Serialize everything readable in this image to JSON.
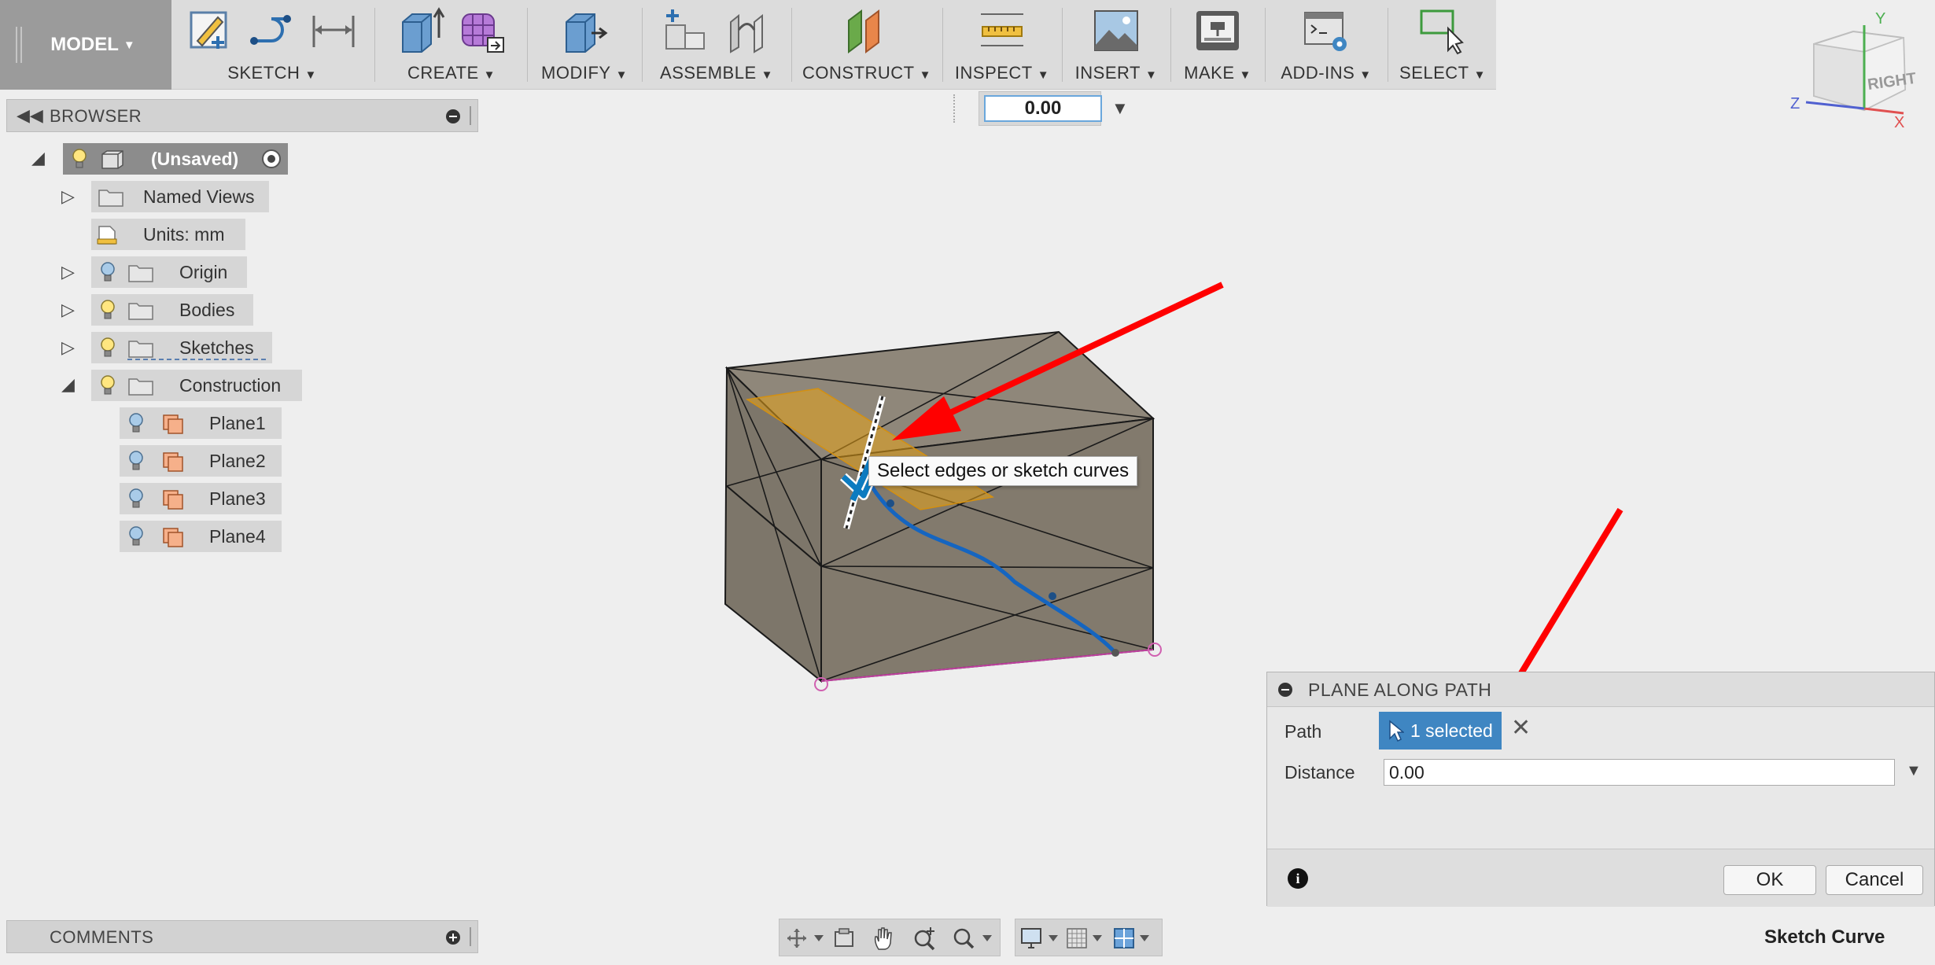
{
  "toolbar": {
    "workspace_label": "MODEL",
    "groups": [
      {
        "label": "SKETCH"
      },
      {
        "label": "CREATE"
      },
      {
        "label": "MODIFY"
      },
      {
        "label": "ASSEMBLE"
      },
      {
        "label": "CONSTRUCT"
      },
      {
        "label": "INSPECT"
      },
      {
        "label": "INSERT"
      },
      {
        "label": "MAKE"
      },
      {
        "label": "ADD-INS"
      },
      {
        "label": "SELECT"
      }
    ],
    "value_field": "0.00"
  },
  "browser": {
    "title": "BROWSER",
    "root": {
      "label": "(Unsaved)"
    },
    "items": [
      {
        "label": "Named Views"
      },
      {
        "label": "Units: mm"
      },
      {
        "label": "Origin"
      },
      {
        "label": "Bodies"
      },
      {
        "label": "Sketches"
      },
      {
        "label": "Construction"
      },
      {
        "label": "Plane1"
      },
      {
        "label": "Plane2"
      },
      {
        "label": "Plane3"
      },
      {
        "label": "Plane4"
      }
    ]
  },
  "viewport": {
    "tooltip": "Select edges or sketch curves",
    "viewcube_face": "RIGHT",
    "axes": {
      "x": "X",
      "y": "Y",
      "z": "Z"
    }
  },
  "dialog": {
    "title": "PLANE ALONG PATH",
    "path_label": "Path",
    "path_value": "1 selected",
    "distance_label": "Distance",
    "distance_value": "0.00",
    "ok_label": "OK",
    "cancel_label": "Cancel"
  },
  "comments": {
    "title": "COMMENTS"
  },
  "status": {
    "text": "Sketch Curve"
  },
  "colors": {
    "accent": "#3f86c2",
    "annotation_arrow": "#ff0000",
    "path_curve": "#1565c0",
    "plane_orange": "#e8a317"
  }
}
